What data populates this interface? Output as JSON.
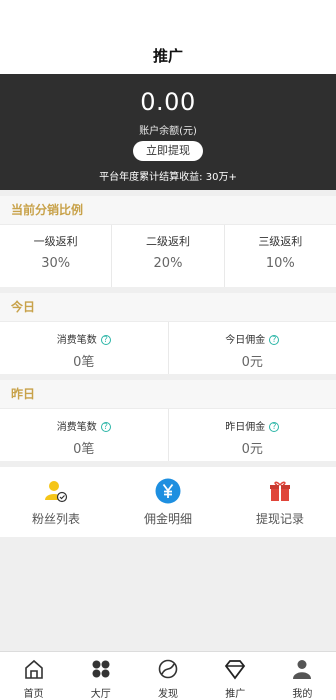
{
  "header": {
    "title": "推广"
  },
  "account": {
    "balance": "0.00",
    "balance_label": "账户余额(元)",
    "withdraw_button": "立即提现",
    "income_text": "平台年度累计结算收益: 30万+"
  },
  "ratio": {
    "title": "当前分销比例",
    "items": [
      {
        "label": "一级返利",
        "value": "30%"
      },
      {
        "label": "二级返利",
        "value": "20%"
      },
      {
        "label": "三级返利",
        "value": "10%"
      }
    ]
  },
  "today": {
    "title": "今日",
    "items": [
      {
        "label": "消费笔数",
        "value": "0笔"
      },
      {
        "label": "今日佣金",
        "value": "0元"
      }
    ]
  },
  "yesterday": {
    "title": "昨日",
    "items": [
      {
        "label": "消费笔数",
        "value": "0笔"
      },
      {
        "label": "昨日佣金",
        "value": "0元"
      }
    ]
  },
  "tools": [
    {
      "label": "粉丝列表",
      "icon": "fans-icon"
    },
    {
      "label": "佣金明细",
      "icon": "yen-icon"
    },
    {
      "label": "提现记录",
      "icon": "gift-icon"
    }
  ],
  "help_icon": {
    "glyph": "?",
    "name": "help-icon"
  },
  "tabbar": [
    {
      "label": "首页",
      "icon": "home-icon"
    },
    {
      "label": "大厅",
      "icon": "grid-icon"
    },
    {
      "label": "发现",
      "icon": "discover-icon"
    },
    {
      "label": "推广",
      "icon": "diamond-icon"
    },
    {
      "label": "我的",
      "icon": "user-icon"
    }
  ],
  "colors": {
    "gold": "#c8a24a",
    "teal": "#2bb5a7",
    "blue": "#1e8fe0",
    "red": "#e0453a",
    "dark": "#2f2f2f"
  }
}
